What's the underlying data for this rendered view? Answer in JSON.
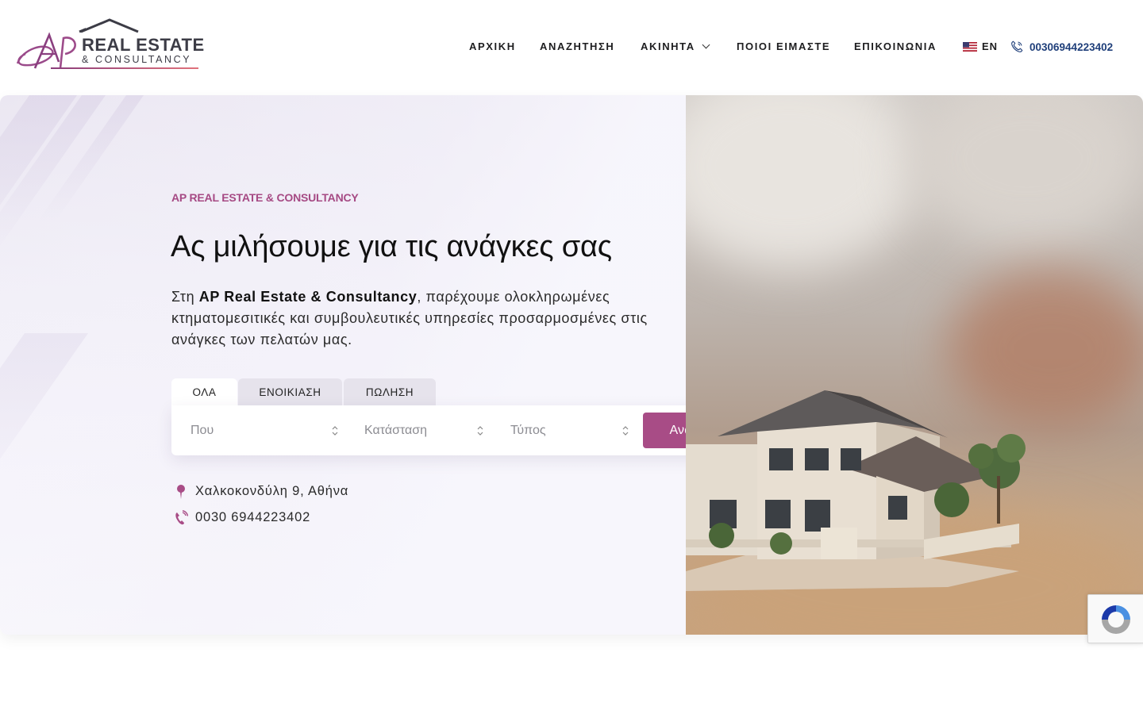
{
  "brand": {
    "logo_monogram": "AP",
    "name_line1": "REAL ESTATE",
    "name_line2": "& CONSULTANCY"
  },
  "nav": {
    "items": [
      {
        "label": "ΑΡΧΙΚΗ"
      },
      {
        "label": "ΑΝΑΖΗΤΗΣΗ"
      },
      {
        "label": "ΑΚΙΝΗΤΑ",
        "has_dropdown": true
      },
      {
        "label": "ΠΟΙΟΙ ΕΙΜΑΣΤΕ"
      },
      {
        "label": "ΕΠΙΚΟΙΝΩΝΙΑ"
      }
    ],
    "language": {
      "flag_icon": "us-flag-icon",
      "label": "EN"
    },
    "phone": {
      "icon": "phone-icon",
      "label": "00306944223402"
    }
  },
  "hero": {
    "eyebrow": "AP REAL ESTATE & CONSULTANCY",
    "title": "Ας μιλήσουμε για τις ανάγκες σας",
    "desc_prefix": "Στη ",
    "desc_bold": "AP Real Estate & Consultancy",
    "desc_suffix": ", παρέχουμε ολοκληρωμένες κτηματομεσιτικές και συμβουλευτικές υπηρεσίες προσαρμοσμένες στις ανάγκες των πελατών μας.",
    "image_alt": "house-model-image"
  },
  "search": {
    "tabs": [
      {
        "label": "ΟΛΑ",
        "active": true
      },
      {
        "label": "ΕΝΟΙΚΙΑΣΗ",
        "active": false
      },
      {
        "label": "ΠΩΛΗΣΗ",
        "active": false
      }
    ],
    "location_placeholder": "Που",
    "status_placeholder": "Κατάσταση",
    "type_placeholder": "Τύπος",
    "button_label": "Αναζήτηση"
  },
  "contact": {
    "address": "Χαλκοκονδύλη 9, Αθήνα",
    "phone": "0030 6944223402"
  },
  "colors": {
    "accent": "#a84c86",
    "eyebrow": "#a64a84",
    "phone_link": "#1f3f7a"
  }
}
